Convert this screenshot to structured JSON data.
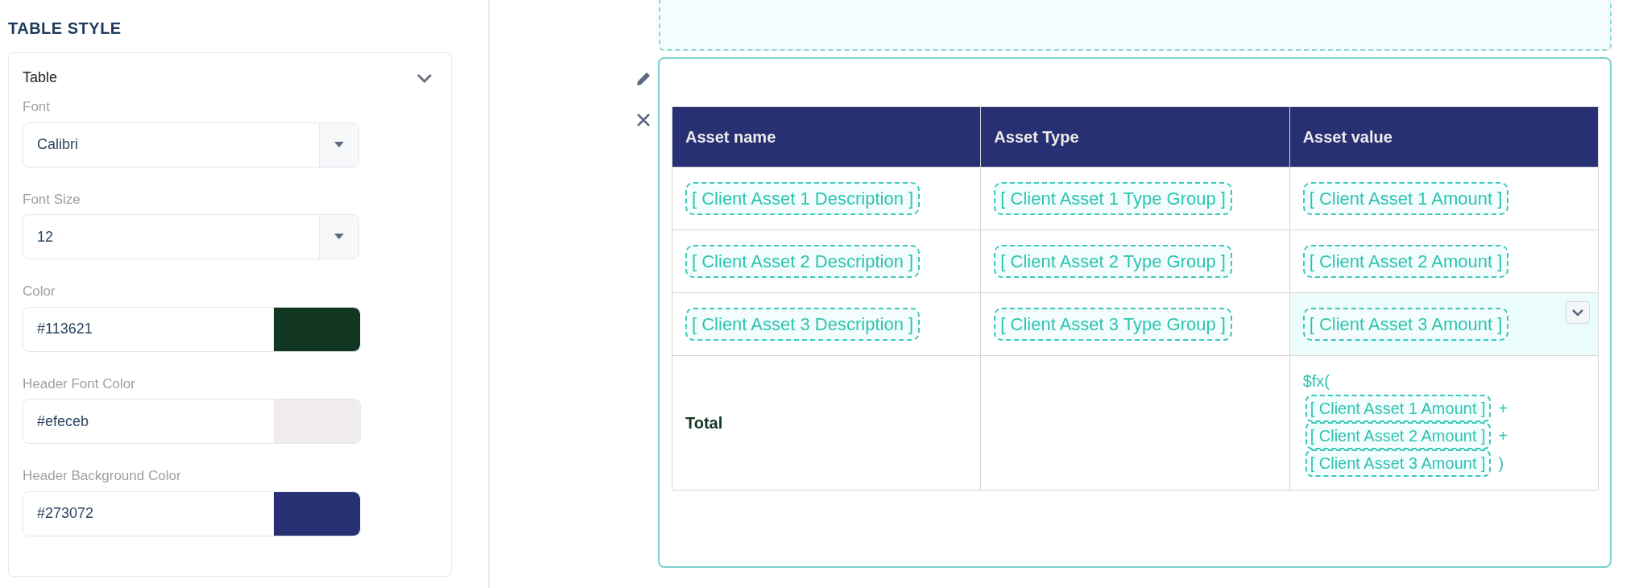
{
  "panel": {
    "title": "TABLE STYLE",
    "section": {
      "title": "Table",
      "expanded": true,
      "fields": [
        {
          "kind": "select",
          "label": "Font",
          "value": "Calibri"
        },
        {
          "kind": "select",
          "label": "Font Size",
          "value": "12"
        },
        {
          "kind": "color",
          "label": "Color",
          "value": "#113621",
          "color": "#113621"
        },
        {
          "kind": "color",
          "label": "Header Font Color",
          "value": "#efeceb",
          "color": "#efeceb"
        },
        {
          "kind": "color",
          "label": "Header Background Color",
          "value": "#273072",
          "color": "#273072"
        }
      ]
    }
  },
  "table": {
    "columns": [
      "Asset name",
      "Asset Type",
      "Asset value"
    ],
    "rows": [
      {
        "cells": [
          {
            "kind": "token",
            "text": "[ Client Asset 1 Description ]",
            "selected": false
          },
          {
            "kind": "token",
            "text": "[ Client Asset 1 Type Group ]",
            "selected": false
          },
          {
            "kind": "token",
            "text": "[ Client Asset 1 Amount ]",
            "selected": false
          }
        ]
      },
      {
        "cells": [
          {
            "kind": "token",
            "text": "[ Client Asset 2 Description ]",
            "selected": false
          },
          {
            "kind": "token",
            "text": "[ Client Asset 2 Type Group ]",
            "selected": false
          },
          {
            "kind": "token",
            "text": "[ Client Asset 2 Amount ]",
            "selected": false
          }
        ]
      },
      {
        "cells": [
          {
            "kind": "token",
            "text": "[ Client Asset 3 Description ]",
            "selected": false
          },
          {
            "kind": "token",
            "text": "[ Client Asset 3 Type Group ]",
            "selected": false
          },
          {
            "kind": "token",
            "text": "[ Client Asset 3 Amount ]",
            "selected": true
          }
        ]
      },
      {
        "cells": [
          {
            "kind": "label",
            "text": "Total",
            "selected": false
          },
          {
            "kind": "blank",
            "selected": false
          },
          {
            "kind": "formula",
            "prefix": "$fx(",
            "terms": [
              {
                "token": "[ Client Asset 1 Amount ]",
                "operator": "+"
              },
              {
                "token": "[ Client Asset 2 Amount ]",
                "operator": "+"
              },
              {
                "token": "[ Client Asset 3 Amount ]",
                "operator": ")"
              }
            ],
            "selected": false
          }
        ]
      }
    ]
  }
}
